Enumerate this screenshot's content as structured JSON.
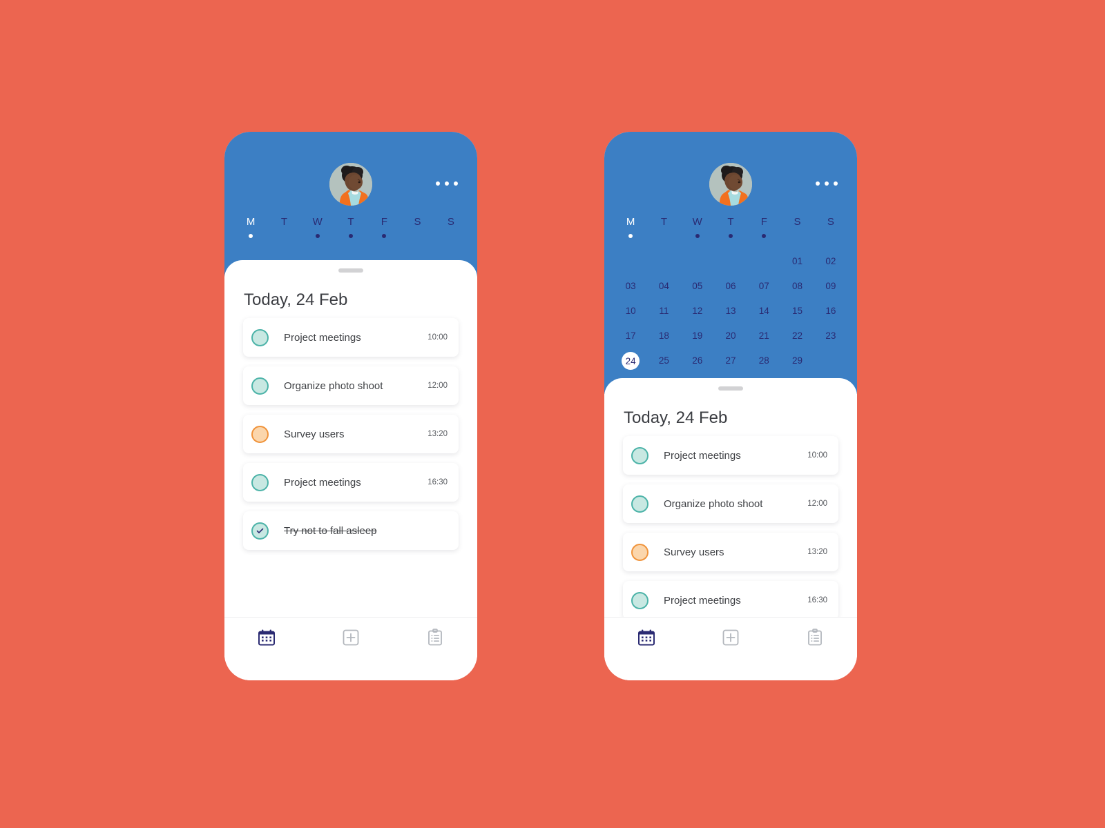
{
  "meta": {
    "background_color": "#ec6550",
    "header_color": "#3c7fc4",
    "accent_navy": "#2a2a72",
    "teal_fill": "#c8e8e2",
    "teal_border": "#4cb3a8",
    "orange_fill": "#fbd6ac",
    "orange_border": "#f0943c"
  },
  "header": {
    "avatar_alt": "user-avatar",
    "menu_icon": "more-options-icon",
    "weekdays": [
      {
        "letter": "M",
        "active": true,
        "has_dot": true
      },
      {
        "letter": "T",
        "active": false,
        "has_dot": false
      },
      {
        "letter": "W",
        "active": false,
        "has_dot": true
      },
      {
        "letter": "T",
        "active": false,
        "has_dot": true
      },
      {
        "letter": "F",
        "active": false,
        "has_dot": true
      },
      {
        "letter": "S",
        "active": false,
        "has_dot": false
      },
      {
        "letter": "S",
        "active": false,
        "has_dot": false
      }
    ]
  },
  "calendar": {
    "weeks": [
      [
        "",
        "",
        "",
        "",
        "",
        "01",
        "02"
      ],
      [
        "03",
        "04",
        "05",
        "06",
        "07",
        "08",
        "09"
      ],
      [
        "10",
        "11",
        "12",
        "13",
        "14",
        "15",
        "16"
      ],
      [
        "17",
        "18",
        "19",
        "20",
        "21",
        "22",
        "23"
      ],
      [
        "24",
        "25",
        "26",
        "27",
        "28",
        "29",
        ""
      ]
    ],
    "selected_day": "24"
  },
  "sheet": {
    "title": "Today, 24 Feb",
    "handle": "drag-handle"
  },
  "tasks_left": [
    {
      "label": "Project meetings",
      "time": "10:00",
      "color": "teal",
      "done": false
    },
    {
      "label": "Organize photo shoot",
      "time": "12:00",
      "color": "teal",
      "done": false
    },
    {
      "label": "Survey users",
      "time": "13:20",
      "color": "orange",
      "done": false
    },
    {
      "label": "Project meetings",
      "time": "16:30",
      "color": "teal",
      "done": false
    },
    {
      "label": "Try not to fall asleep",
      "time": "",
      "color": "teal",
      "done": true
    }
  ],
  "tasks_right": [
    {
      "label": "Project meetings",
      "time": "10:00",
      "color": "teal",
      "done": false
    },
    {
      "label": "Organize photo shoot",
      "time": "12:00",
      "color": "teal",
      "done": false
    },
    {
      "label": "Survey users",
      "time": "13:20",
      "color": "orange",
      "done": false
    },
    {
      "label": "Project meetings",
      "time": "16:30",
      "color": "teal",
      "done": false
    }
  ],
  "bottom_nav": [
    {
      "icon": "calendar-icon",
      "active": true
    },
    {
      "icon": "plus-icon",
      "active": false
    },
    {
      "icon": "clipboard-icon",
      "active": false
    }
  ]
}
